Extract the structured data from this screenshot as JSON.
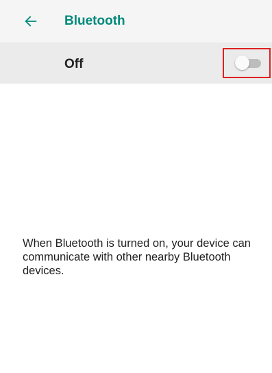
{
  "header": {
    "back_icon": "arrow-left-icon",
    "title": "Bluetooth",
    "accent_color": "#00897b"
  },
  "toggle": {
    "label": "Off",
    "state": "off"
  },
  "description": {
    "text": "When Bluetooth is turned on, your device can communicate with other nearby Bluetooth devices."
  }
}
